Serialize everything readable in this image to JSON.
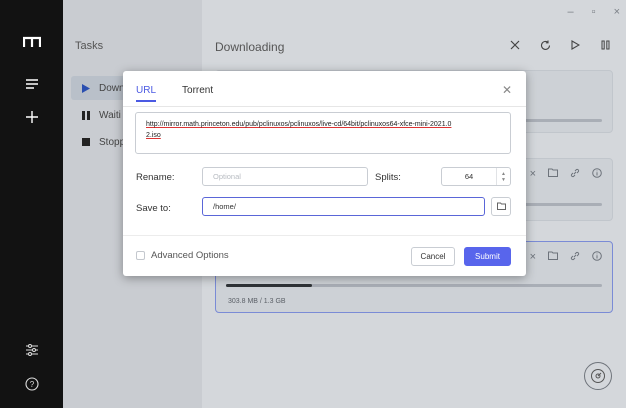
{
  "window": {
    "controls": [
      "–",
      "▫",
      "×"
    ]
  },
  "rail": {
    "icons": [
      "logo-icon",
      "menu-icon",
      "plus-icon",
      "settings-sliders-icon",
      "help-icon"
    ]
  },
  "tasks": {
    "title": "Tasks",
    "items": [
      {
        "label": "Downl",
        "icon": "play-icon"
      },
      {
        "label": "Waiti",
        "icon": "pause-icon"
      },
      {
        "label": "Stopp",
        "icon": "stop-icon"
      }
    ]
  },
  "main": {
    "title": "Downloading",
    "toolbar": [
      "close-icon",
      "refresh-icon",
      "play-icon",
      "pause-icon"
    ],
    "cards": [
      {
        "size": "",
        "progress": 0
      },
      {
        "size": "",
        "progress": 0
      },
      {
        "size": "303.8 MB / 1.3 GB",
        "progress": 0.23
      }
    ]
  },
  "dialog": {
    "tabs": [
      "URL",
      "Torrent"
    ],
    "active_tab": "URL",
    "url_line1": "http://mirror.math.princeton.edu/pub/pclinuxos/pclinuxos/live-cd/64bit/pclinuxos64-xfce-mini-2021.0",
    "url_line2": "2.iso",
    "rename_label": "Rename:",
    "rename_placeholder": "Optional",
    "splits_label": "Splits:",
    "splits_value": "64",
    "save_label": "Save to:",
    "save_value": "/home/",
    "advanced_label": "Advanced Options",
    "cancel_label": "Cancel",
    "submit_label": "Submit"
  },
  "colors": {
    "accent": "#5865ec",
    "rail": "#121212"
  }
}
